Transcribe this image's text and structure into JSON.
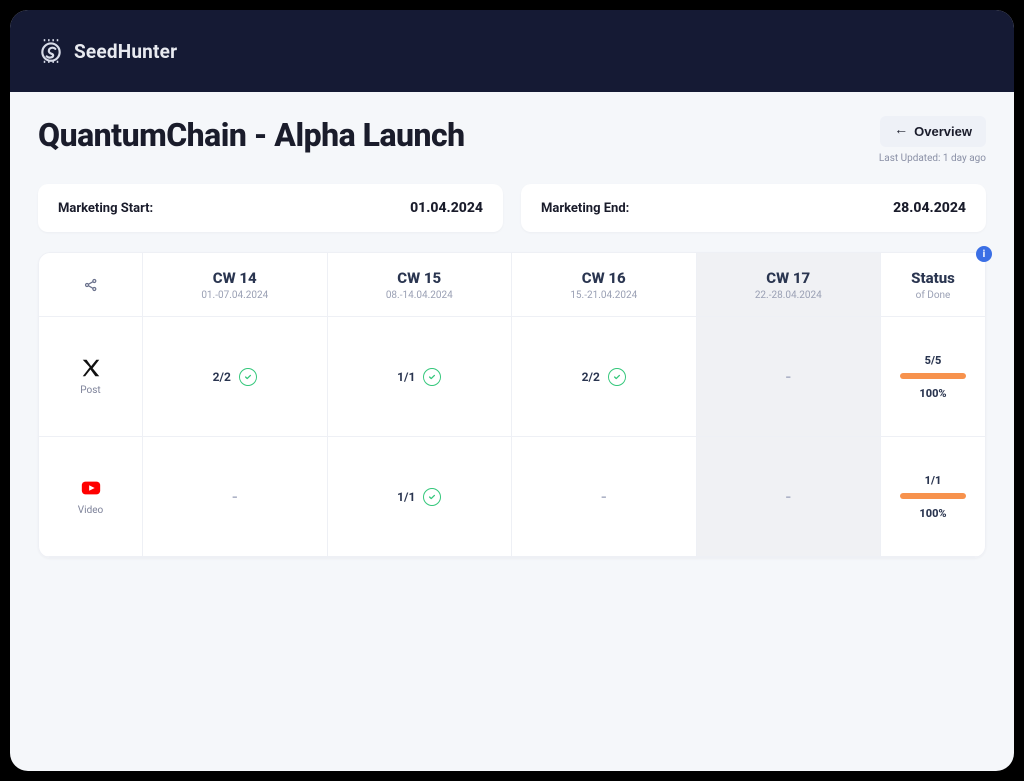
{
  "brand": {
    "name": "SeedHunter"
  },
  "header": {
    "title": "QuantumChain - Alpha Launch",
    "overview_button": "Overview",
    "last_updated": "Last Updated: 1 day ago"
  },
  "cards": {
    "start": {
      "label": "Marketing Start:",
      "value": "01.04.2024"
    },
    "end": {
      "label": "Marketing End:",
      "value": "28.04.2024"
    }
  },
  "info_badge": "i",
  "columns": [
    {
      "title": "CW 14",
      "range": "01.-07.04.2024",
      "highlight": false
    },
    {
      "title": "CW 15",
      "range": "08.-14.04.2024",
      "highlight": false
    },
    {
      "title": "CW 16",
      "range": "15.-21.04.2024",
      "highlight": false
    },
    {
      "title": "CW 17",
      "range": "22.-28.04.2024",
      "highlight": true
    }
  ],
  "status_header": {
    "title": "Status",
    "sub": "of Done"
  },
  "rows": [
    {
      "icon": "x-post-icon",
      "label": "Post",
      "cells": [
        {
          "value": "2/2",
          "done": true
        },
        {
          "value": "1/1",
          "done": true
        },
        {
          "value": "2/2",
          "done": true
        },
        {
          "value": "-",
          "done": false
        }
      ],
      "status": {
        "count": "5/5",
        "pct": "100%"
      }
    },
    {
      "icon": "youtube-icon",
      "label": "Video",
      "cells": [
        {
          "value": "-",
          "done": false
        },
        {
          "value": "1/1",
          "done": true
        },
        {
          "value": "-",
          "done": false
        },
        {
          "value": "-",
          "done": false
        }
      ],
      "status": {
        "count": "1/1",
        "pct": "100%"
      }
    }
  ]
}
